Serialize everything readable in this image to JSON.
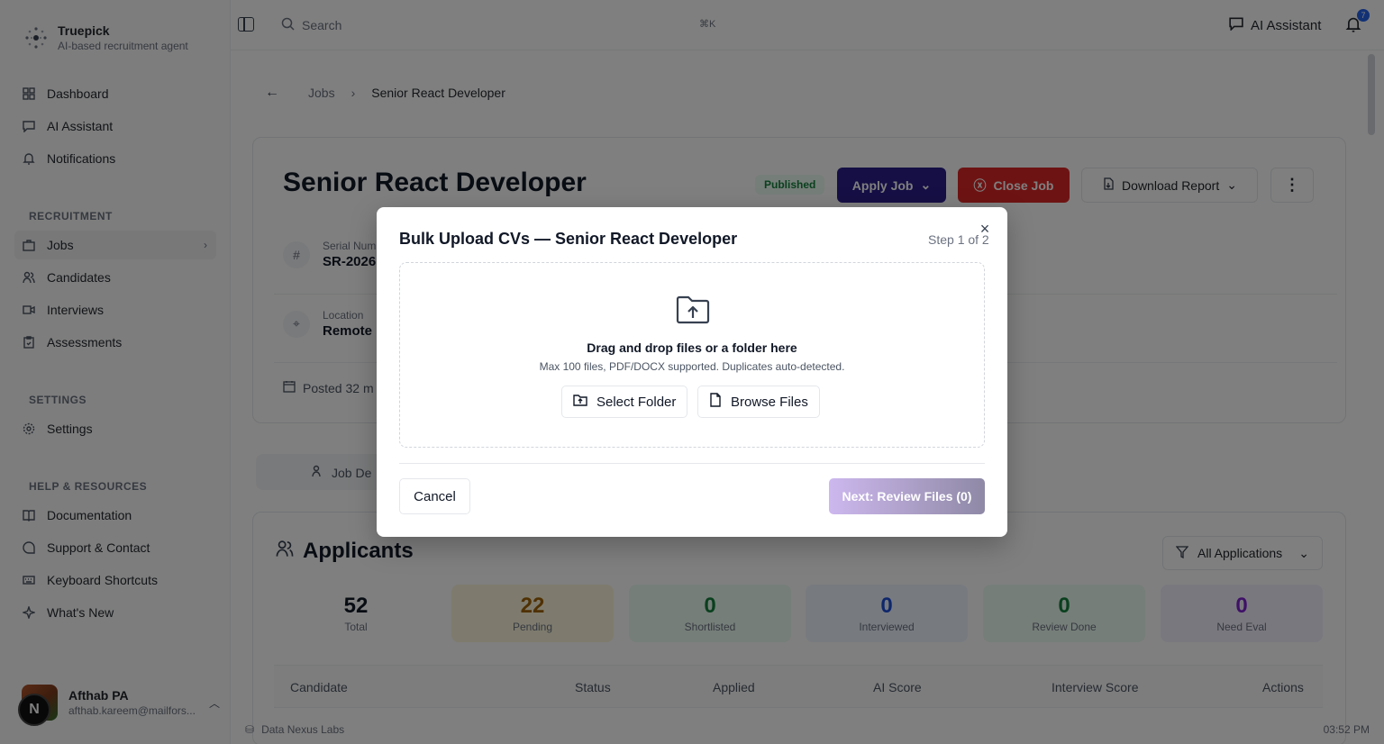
{
  "app": {
    "name": "Truepick",
    "tagline": "AI-based recruitment agent"
  },
  "sidebar": {
    "main_items": [
      {
        "label": "Dashboard",
        "icon": "dashboard-icon"
      },
      {
        "label": "AI Assistant",
        "icon": "chat-icon"
      },
      {
        "label": "Notifications",
        "icon": "bell-icon"
      }
    ],
    "recruitment_label": "RECRUITMENT",
    "recruitment_items": [
      {
        "label": "Jobs",
        "icon": "briefcase-icon",
        "active": true
      },
      {
        "label": "Candidates",
        "icon": "users-icon"
      },
      {
        "label": "Interviews",
        "icon": "video-icon"
      },
      {
        "label": "Assessments",
        "icon": "clipboard-icon"
      }
    ],
    "settings_label": "SETTINGS",
    "settings_items": [
      {
        "label": "Settings",
        "icon": "gear-icon"
      }
    ],
    "help_label": "HELP & RESOURCES",
    "help_items": [
      {
        "label": "Documentation",
        "icon": "book-icon"
      },
      {
        "label": "Support & Contact",
        "icon": "message-icon"
      },
      {
        "label": "Keyboard Shortcuts",
        "icon": "keyboard-icon"
      },
      {
        "label": "What's New",
        "icon": "sparkle-icon"
      }
    ],
    "user": {
      "name": "Afthab PA",
      "email": "afthab.kareem@mailfors..."
    },
    "next_badge": "N"
  },
  "topbar": {
    "search_placeholder": "Search",
    "shortcut": "⌘K",
    "ai_assistant": "AI Assistant",
    "notification_count": "7"
  },
  "breadcrumb": {
    "parent": "Jobs",
    "current": "Senior React Developer"
  },
  "job": {
    "title": "Senior React Developer",
    "status": "Published",
    "apply_label": "Apply Job",
    "close_label": "Close Job",
    "download_label": "Download Report",
    "serial_label": "Serial Num",
    "serial_value": "SR-2026",
    "location_label": "Location",
    "location_value": "Remote",
    "posted": "Posted 32 m",
    "tab_label": "Job De"
  },
  "applicants": {
    "title": "Applicants",
    "filter": "All Applications",
    "stats": [
      {
        "num": "52",
        "label": "Total",
        "bg": "#ffffff",
        "color": "#111827"
      },
      {
        "num": "22",
        "label": "Pending",
        "bg": "#fdf6dc",
        "color": "#a16207"
      },
      {
        "num": "0",
        "label": "Shortlisted",
        "bg": "#ecfdf3",
        "color": "#15803d"
      },
      {
        "num": "0",
        "label": "Interviewed",
        "bg": "#eef4ff",
        "color": "#1d4ed8"
      },
      {
        "num": "0",
        "label": "Review Done",
        "bg": "#ecfdf3",
        "color": "#15803d"
      },
      {
        "num": "0",
        "label": "Need Eval",
        "bg": "#f5f0ff",
        "color": "#7e22ce"
      }
    ],
    "columns": [
      "Candidate",
      "Status",
      "Applied",
      "AI Score",
      "Interview Score",
      "Actions"
    ]
  },
  "footer": {
    "org": "Data Nexus Labs",
    "time": "03:52 PM"
  },
  "modal": {
    "title": "Bulk Upload CVs — Senior React Developer",
    "step": "Step 1 of 2",
    "drop_title": "Drag and drop files or a folder here",
    "drop_sub": "Max 100 files, PDF/DOCX supported. Duplicates auto-detected.",
    "select_folder": "Select Folder",
    "browse_files": "Browse Files",
    "cancel": "Cancel",
    "next": "Next: Review Files (0)"
  },
  "colors": {
    "accent": "#2b1f8a",
    "danger": "#dc2626",
    "success": "#15803d"
  }
}
